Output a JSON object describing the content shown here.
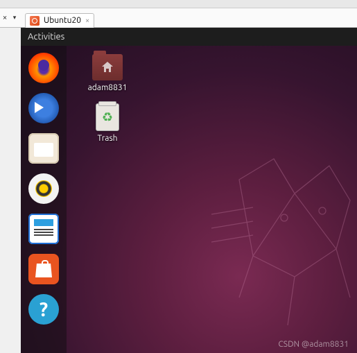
{
  "host": {
    "tab_label": "Ubuntu20",
    "close": "×",
    "dropdown": "▾",
    "tab_close": "×"
  },
  "topbar": {
    "activities": "Activities"
  },
  "dock": {
    "items": [
      {
        "name": "Firefox"
      },
      {
        "name": "Thunderbird"
      },
      {
        "name": "Files"
      },
      {
        "name": "Rhythmbox"
      },
      {
        "name": "LibreOffice Writer"
      },
      {
        "name": "Ubuntu Software"
      },
      {
        "name": "Help"
      }
    ],
    "help_glyph": "?"
  },
  "desktop_icons": {
    "home": {
      "label": "adam8831"
    },
    "trash": {
      "label": "Trash",
      "glyph": "♻"
    }
  },
  "watermark": "CSDN @adam8831"
}
